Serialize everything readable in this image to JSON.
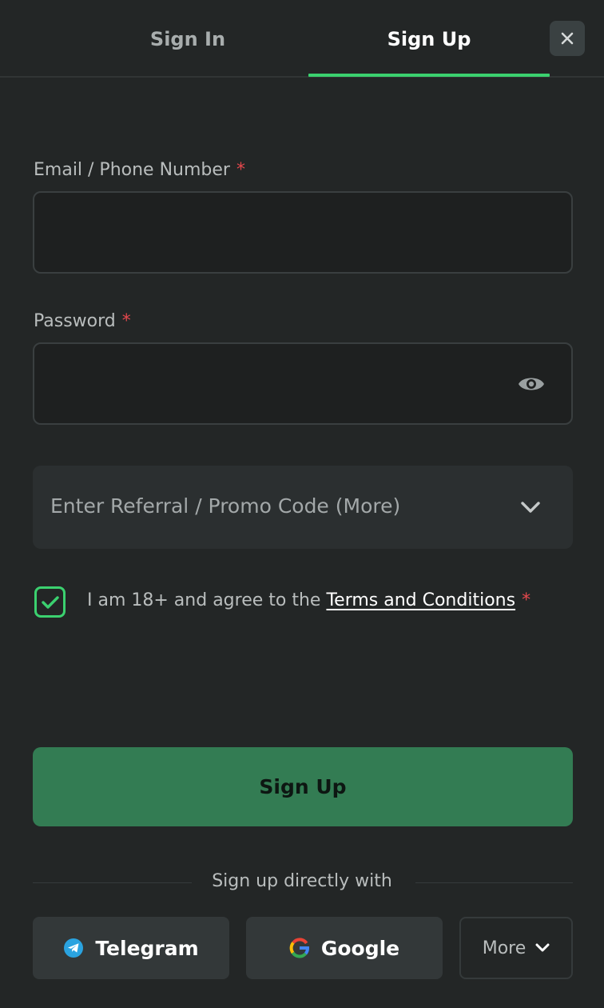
{
  "tabs": [
    {
      "label": "Sign In",
      "active": false
    },
    {
      "label": "Sign Up",
      "active": true
    }
  ],
  "close_icon": "close-icon",
  "form": {
    "email_label": "Email / Phone Number",
    "email_value": "",
    "password_label": "Password",
    "password_value": "",
    "required_marker": "*",
    "promo_placeholder": "Enter Referral / Promo Code (More)",
    "agree_prefix": "I am 18+ and agree to the",
    "terms_link": "Terms and Conditions",
    "agree_checked": true,
    "submit_label": "Sign Up"
  },
  "social": {
    "divider": "Sign up directly with",
    "telegram_label": "Telegram",
    "google_label": "Google",
    "more_label": "More"
  },
  "colors": {
    "background": "#232626",
    "accent": "#3bd16f",
    "submit_bg": "#337c53",
    "required": "#e5484d"
  }
}
